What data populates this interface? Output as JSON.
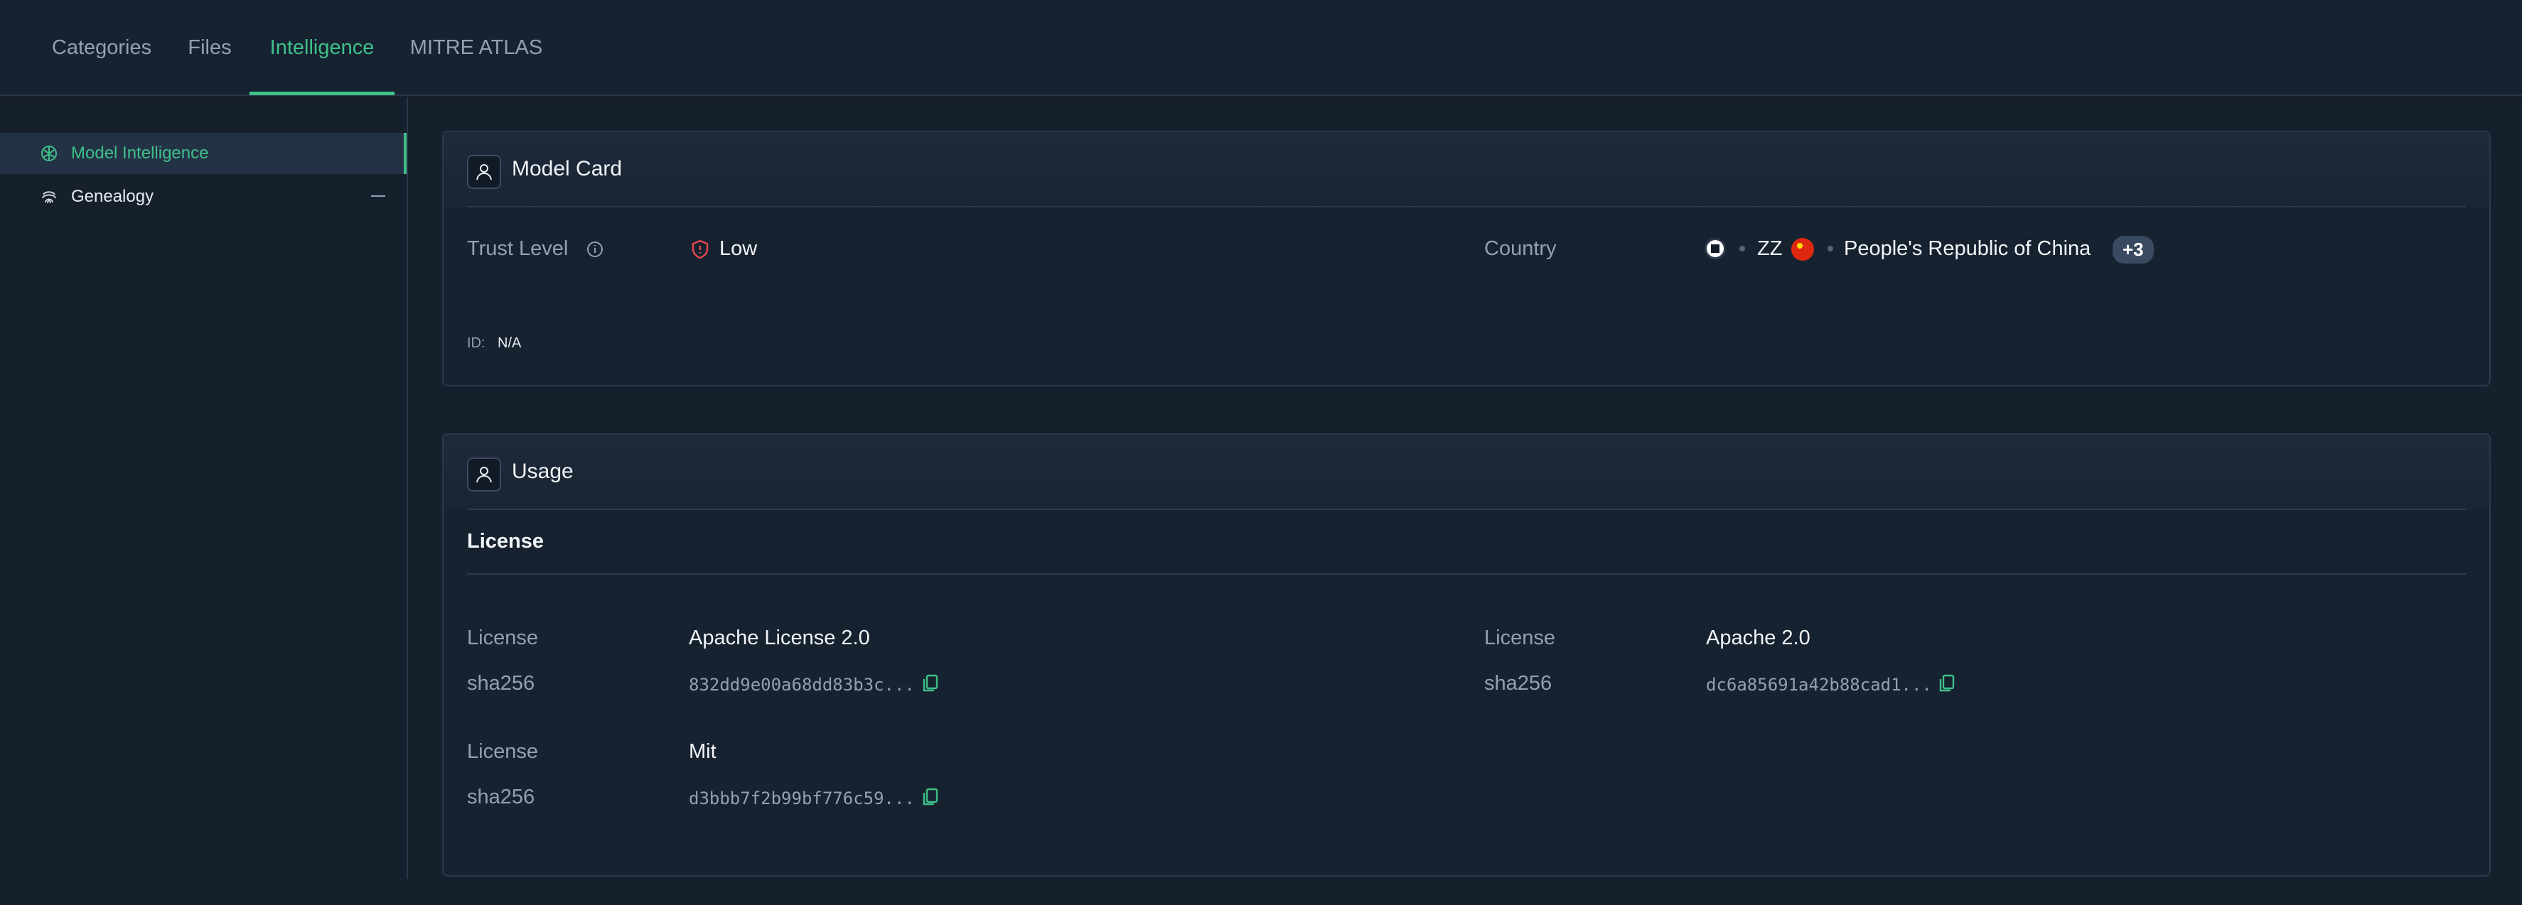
{
  "tabs": [
    {
      "label": "Categories",
      "active": false
    },
    {
      "label": "Files",
      "active": false
    },
    {
      "label": "Intelligence",
      "active": true
    },
    {
      "label": "MITRE ATLAS",
      "active": false
    }
  ],
  "sidebar": {
    "items": [
      {
        "label": "Model Intelligence",
        "icon": "brain-icon",
        "active": true
      },
      {
        "label": "Genealogy",
        "icon": "fingerprint-icon",
        "active": false
      }
    ]
  },
  "model_card": {
    "title": "Model Card",
    "trust_level_label": "Trust Level",
    "trust_level_value": "Low",
    "country_label": "Country",
    "country_code": "ZZ",
    "country_name": "People's Republic of China",
    "country_more": "+3",
    "id_label": "ID:",
    "id_value": "N/A"
  },
  "usage": {
    "title": "Usage",
    "section": "License",
    "licenses": [
      {
        "license_label": "License",
        "license_value": "Apache License 2.0",
        "hash_label": "sha256",
        "hash_value": "832dd9e00a68dd83b3c..."
      },
      {
        "license_label": "License",
        "license_value": "Apache 2.0",
        "hash_label": "sha256",
        "hash_value": "dc6a85691a42b88cad1..."
      },
      {
        "license_label": "License",
        "license_value": "Mit",
        "hash_label": "sha256",
        "hash_value": "d3bbb7f2b99bf776c59..."
      }
    ]
  },
  "colors": {
    "accent": "#3ec08a",
    "background": "#16202c",
    "danger": "#e5484d"
  }
}
